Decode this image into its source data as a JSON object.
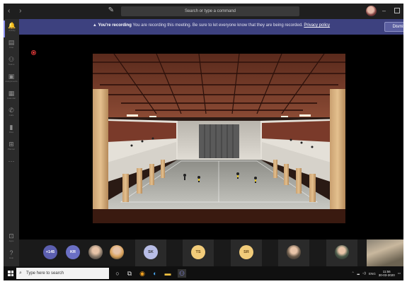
{
  "titlebar": {
    "nav_arrows": "‹ ›",
    "compose_icon": "compose-icon",
    "search_placeholder": "Search or type a command",
    "minimize": "–"
  },
  "banner": {
    "title": "You're recording",
    "message": "You are recording this meeting. Be sure to let everyone know that they are being recorded.",
    "link": "Privacy policy",
    "dismiss": "Dismiss",
    "color": "#3d417f"
  },
  "rail": {
    "items": [
      {
        "label": "Activity",
        "icon": "bell-icon",
        "glyph": "🔔"
      },
      {
        "label": "Chat",
        "icon": "chat-icon",
        "glyph": "▤"
      },
      {
        "label": "Teams",
        "icon": "teams-icon",
        "glyph": "⚇"
      },
      {
        "label": "Assignments",
        "icon": "assignments-icon",
        "glyph": "▣"
      },
      {
        "label": "Calendar",
        "icon": "calendar-icon",
        "glyph": "▦"
      },
      {
        "label": "Calls",
        "icon": "calls-icon",
        "glyph": "✆"
      },
      {
        "label": "Files",
        "icon": "files-icon",
        "glyph": "▮"
      },
      {
        "label": "Planner",
        "icon": "planner-icon",
        "glyph": "⊞"
      },
      {
        "label": "",
        "icon": "more-icon",
        "glyph": "···"
      },
      {
        "label": "Apps",
        "icon": "apps-icon",
        "glyph": "⊡"
      },
      {
        "label": "Help",
        "icon": "help-icon",
        "glyph": "?"
      }
    ]
  },
  "stage": {
    "content": "shared-screen-render-sports-hall"
  },
  "participants": [
    {
      "initials": "+145",
      "color": "#5c5fb0",
      "text_color": "#fff"
    },
    {
      "initials": "KR",
      "color": "#6a6fc4",
      "text_color": "#fff"
    },
    {
      "initials": "",
      "color": "#8a7a6a",
      "photo": true
    },
    {
      "initials": "",
      "color": "#d9a25b",
      "photo": true
    },
    {
      "initials": "SK",
      "color": "#b8bde6",
      "text_color": "#333"
    },
    {
      "initials": "TS",
      "color": "#f2cc7a",
      "text_color": "#6a4a1a"
    },
    {
      "initials": "SR",
      "color": "#f2cc7a",
      "text_color": "#6a4a1a"
    },
    {
      "initials": "",
      "color": "#6a5a4a",
      "photo": true
    },
    {
      "initials": "",
      "color": "#4a5a4a",
      "photo": true
    }
  ],
  "taskbar": {
    "search_placeholder": "Type here to search",
    "tray_lang": "ENG",
    "time": "11:56",
    "date": "30-03-2020"
  }
}
